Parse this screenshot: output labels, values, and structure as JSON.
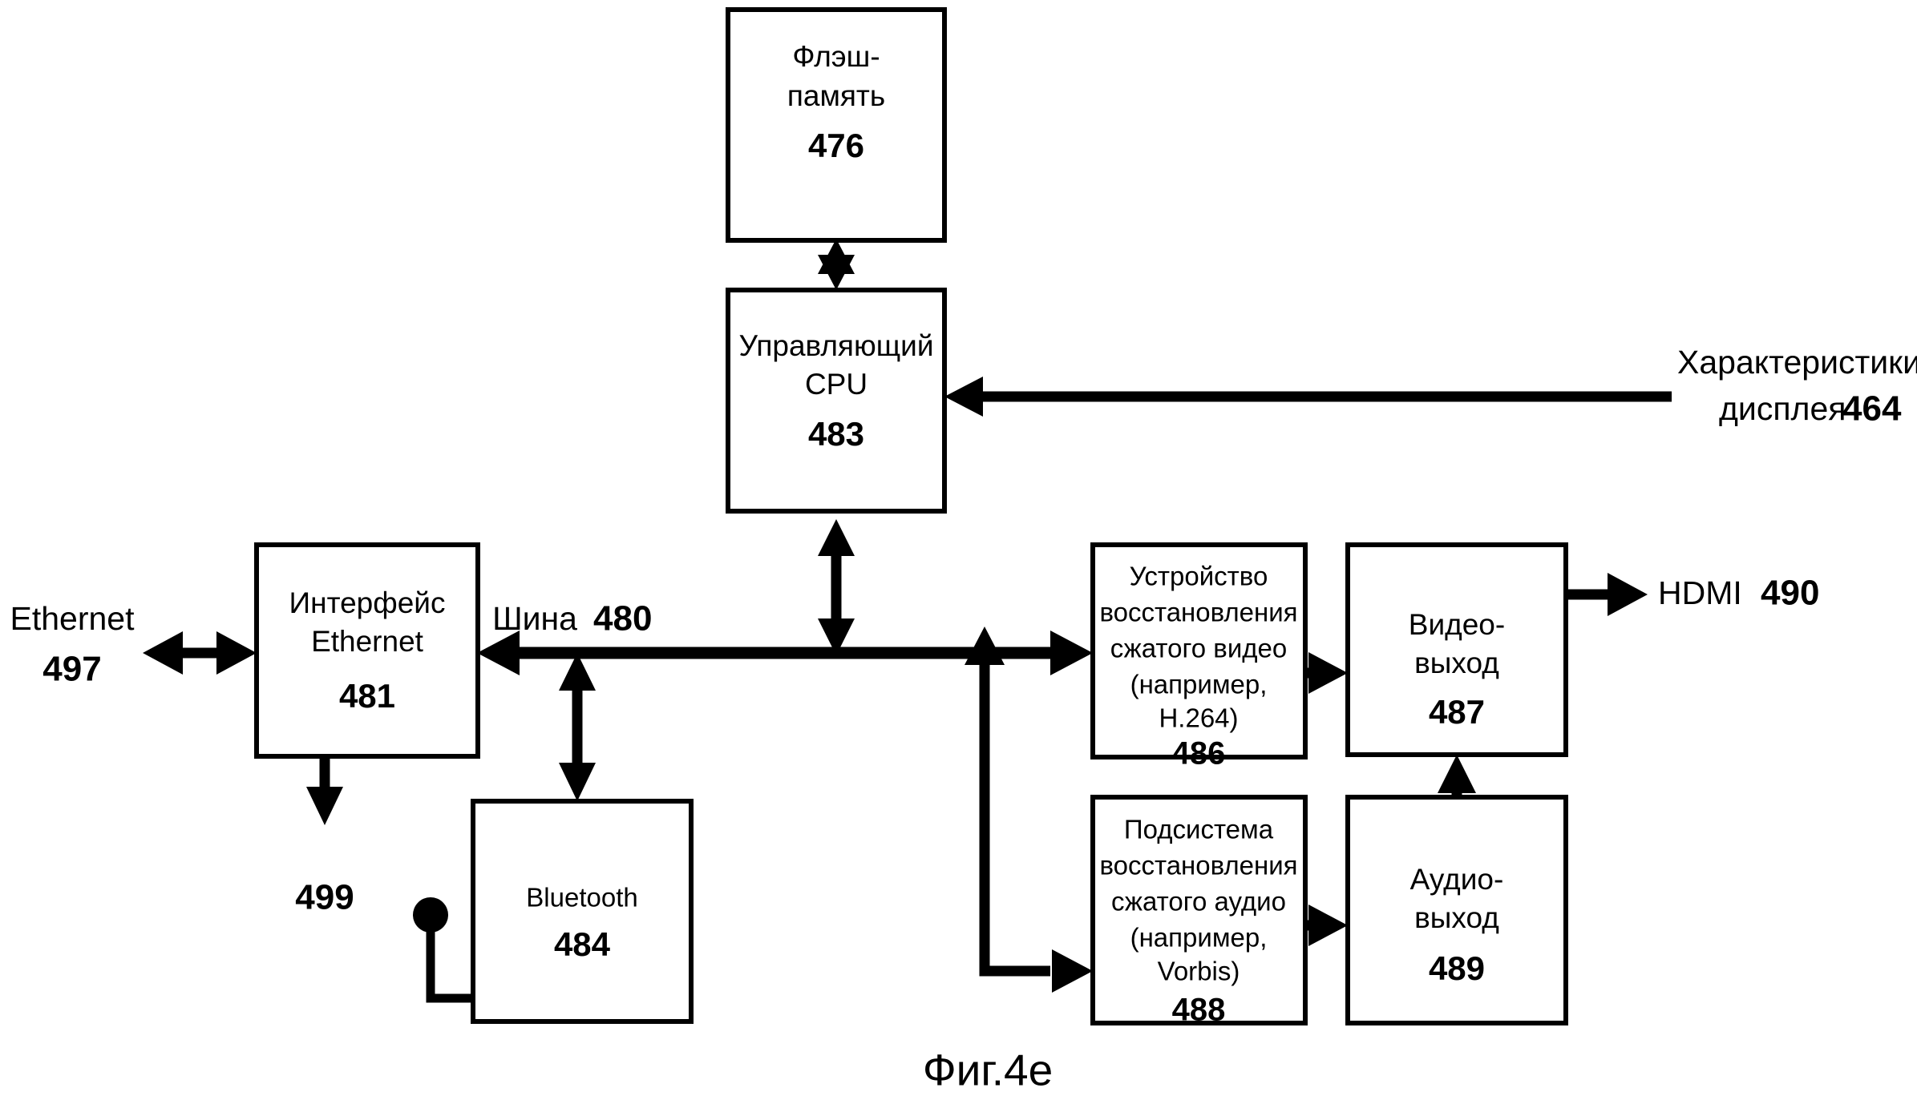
{
  "figure": {
    "caption": "Фиг.4e"
  },
  "blocks": [
    {
      "id": "flash-memory",
      "lines": [
        "Флэш-",
        "память"
      ],
      "number": "476"
    },
    {
      "id": "control-cpu",
      "lines": [
        "Управляющий",
        "CPU"
      ],
      "number": "483"
    },
    {
      "id": "ethernet-interface",
      "lines": [
        "Интерфейс",
        "Ethernet"
      ],
      "number": "481"
    },
    {
      "id": "bluetooth",
      "lines": [
        "Bluetooth"
      ],
      "number": "484"
    },
    {
      "id": "video-decompressor",
      "lines": [
        "Устройство",
        "восстановления",
        "сжатого видео",
        "(например,",
        "H.264)"
      ],
      "number": "486"
    },
    {
      "id": "audio-decompressor",
      "lines": [
        "Подсистема",
        "восстановления",
        "сжатого аудио",
        "(например,",
        "Vorbis)"
      ],
      "number": "488"
    },
    {
      "id": "video-output",
      "lines": [
        "Видео-",
        "выход"
      ],
      "number": "487"
    },
    {
      "id": "audio-output",
      "lines": [
        "Аудио-",
        "выход"
      ],
      "number": "489"
    }
  ],
  "labels": {
    "bus": {
      "text": "Шина",
      "number": "480"
    },
    "display_characteristics": {
      "line1": "Характеристики",
      "line2": "дисплея",
      "number": "464"
    },
    "ethernet_external": {
      "text": "Ethernet",
      "number": "497"
    },
    "hdmi": {
      "text": "HDMI",
      "number": "490"
    },
    "ethernet_out_ref": {
      "number": "499"
    }
  },
  "colors": {
    "line": "#000000",
    "fill": "#ffffff",
    "background": "#ffffff"
  }
}
